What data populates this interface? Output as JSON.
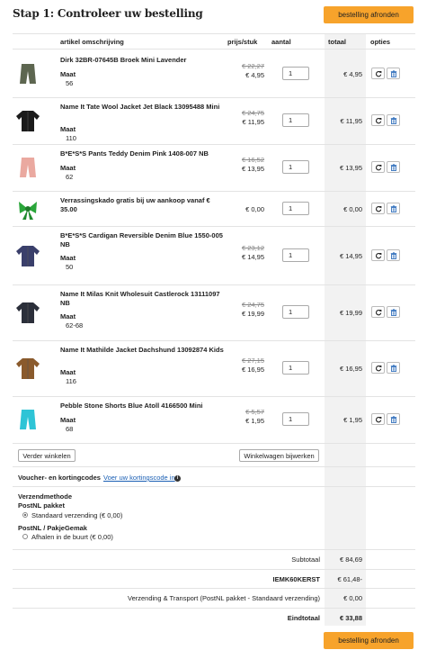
{
  "title": "Stap 1: Controleer uw bestelling",
  "checkout_button": "bestelling afronden",
  "columns": {
    "desc": "artikel omschrijving",
    "price": "prijs/stuk",
    "qty": "aantal",
    "total": "totaal",
    "options": "opties"
  },
  "size_label": "Maat",
  "products": [
    {
      "name": "Dirk 32BR-07645B Broek Mini Lavender",
      "size": "56",
      "old_price": "€ 22,27",
      "price": "€ 4,95",
      "qty": "1",
      "total": "€ 4,95",
      "color": "#5d6650"
    },
    {
      "name": "Name It Tate Wool Jacket Jet Black 13095488 Mini",
      "size": "110",
      "old_price": "€ 24,75",
      "price": "€ 11,95",
      "qty": "1",
      "total": "€ 11,95",
      "color": "#1b1b1b"
    },
    {
      "name": "B*E*S*S Pants Teddy Denim Pink 1408-007 NB",
      "size": "62",
      "old_price": "€ 16,52",
      "price": "€ 13,95",
      "qty": "1",
      "total": "€ 13,95",
      "color": "#eaa9a0"
    },
    {
      "name": "Verrassingskado gratis bij uw aankoop vanaf € 35.00",
      "size": "",
      "old_price": "",
      "price": "€ 0,00",
      "qty": "1",
      "total": "€ 0,00",
      "color": "#2aa63a"
    },
    {
      "name": "B*E*S*S Cardigan Reversible Denim Blue 1550-005 NB",
      "size": "50",
      "old_price": "€ 23,12",
      "price": "€ 14,95",
      "qty": "1",
      "total": "€ 14,95",
      "color": "#3a3f6b"
    },
    {
      "name": "Name It Milas Knit Wholesuit Castlerock 13111097 NB",
      "size": "62-68",
      "old_price": "€ 24,75",
      "price": "€ 19,99",
      "qty": "1",
      "total": "€ 19,99",
      "color": "#2b2f3a"
    },
    {
      "name": "Name It Mathilde Jacket Dachshund 13092874 Kids",
      "size": "116",
      "old_price": "€ 27,15",
      "price": "€ 16,95",
      "qty": "1",
      "total": "€ 16,95",
      "color": "#8a5a2c"
    },
    {
      "name": "Pebble Stone Shorts Blue Atoll 4166500 Mini",
      "size": "68",
      "old_price": "€ 5,57",
      "price": "€ 1,95",
      "qty": "1",
      "total": "€ 1,95",
      "color": "#2ec4d6"
    }
  ],
  "continue_shopping": "Verder winkelen",
  "update_cart": "Winkelwagen bijwerken",
  "voucher_label": "Voucher- en kortingcodes",
  "voucher_link": "Voer uw kortingscode in",
  "shipping": {
    "heading": "Verzendmethode",
    "group1": "PostNL pakket",
    "opt1": "Standaard verzending (€ 0,00)",
    "group2": "PostNL / PakjeGemak",
    "opt2": "Afhalen in de buurt (€ 0,00)"
  },
  "summary": {
    "subtotal_label": "Subtotaal",
    "subtotal": "€ 84,69",
    "discount_label": "IEMK60KERST",
    "discount": "€ 61,48-",
    "shipping_label": "Verzending & Transport (PostNL pakket - Standaard verzending)",
    "shipping": "€ 0,00",
    "total_label": "Eindtotaal",
    "total": "€ 33,88"
  }
}
